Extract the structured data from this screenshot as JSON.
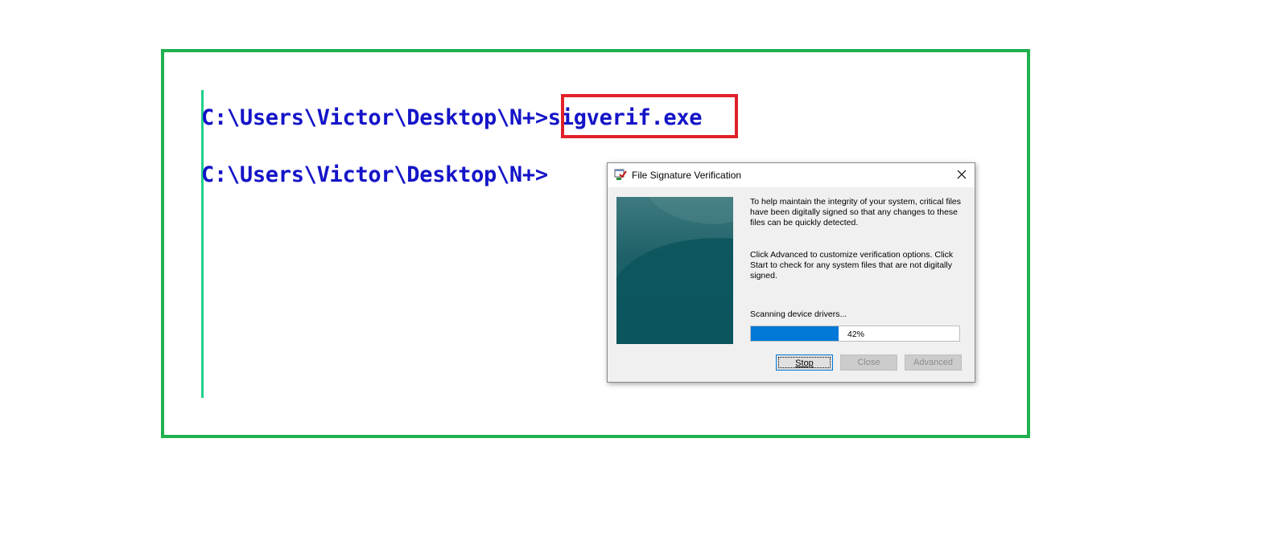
{
  "terminal": {
    "line1_prompt": "C:\\Users\\Victor\\Desktop\\N+>",
    "line1_command": "sigverif.exe",
    "line2_prompt": "C:\\Users\\Victor\\Desktop\\N+>"
  },
  "dialog": {
    "title": "File Signature Verification",
    "description1": "To help maintain the integrity of your system, critical files have been digitally signed so that any changes to these files can be quickly detected.",
    "description2": "Click Advanced to customize verification options. Click Start to check for any system files that are not digitally signed.",
    "status": "Scanning device drivers...",
    "progress_percent": 42,
    "progress_label": "42%",
    "buttons": {
      "stop": "Stop",
      "close": "Close",
      "advanced": "Advanced"
    }
  },
  "colors": {
    "frame_border": "#1fb04f",
    "highlight_border": "#e0212a",
    "terminal_text": "#1414c8",
    "progress_fill": "#0078d7"
  }
}
